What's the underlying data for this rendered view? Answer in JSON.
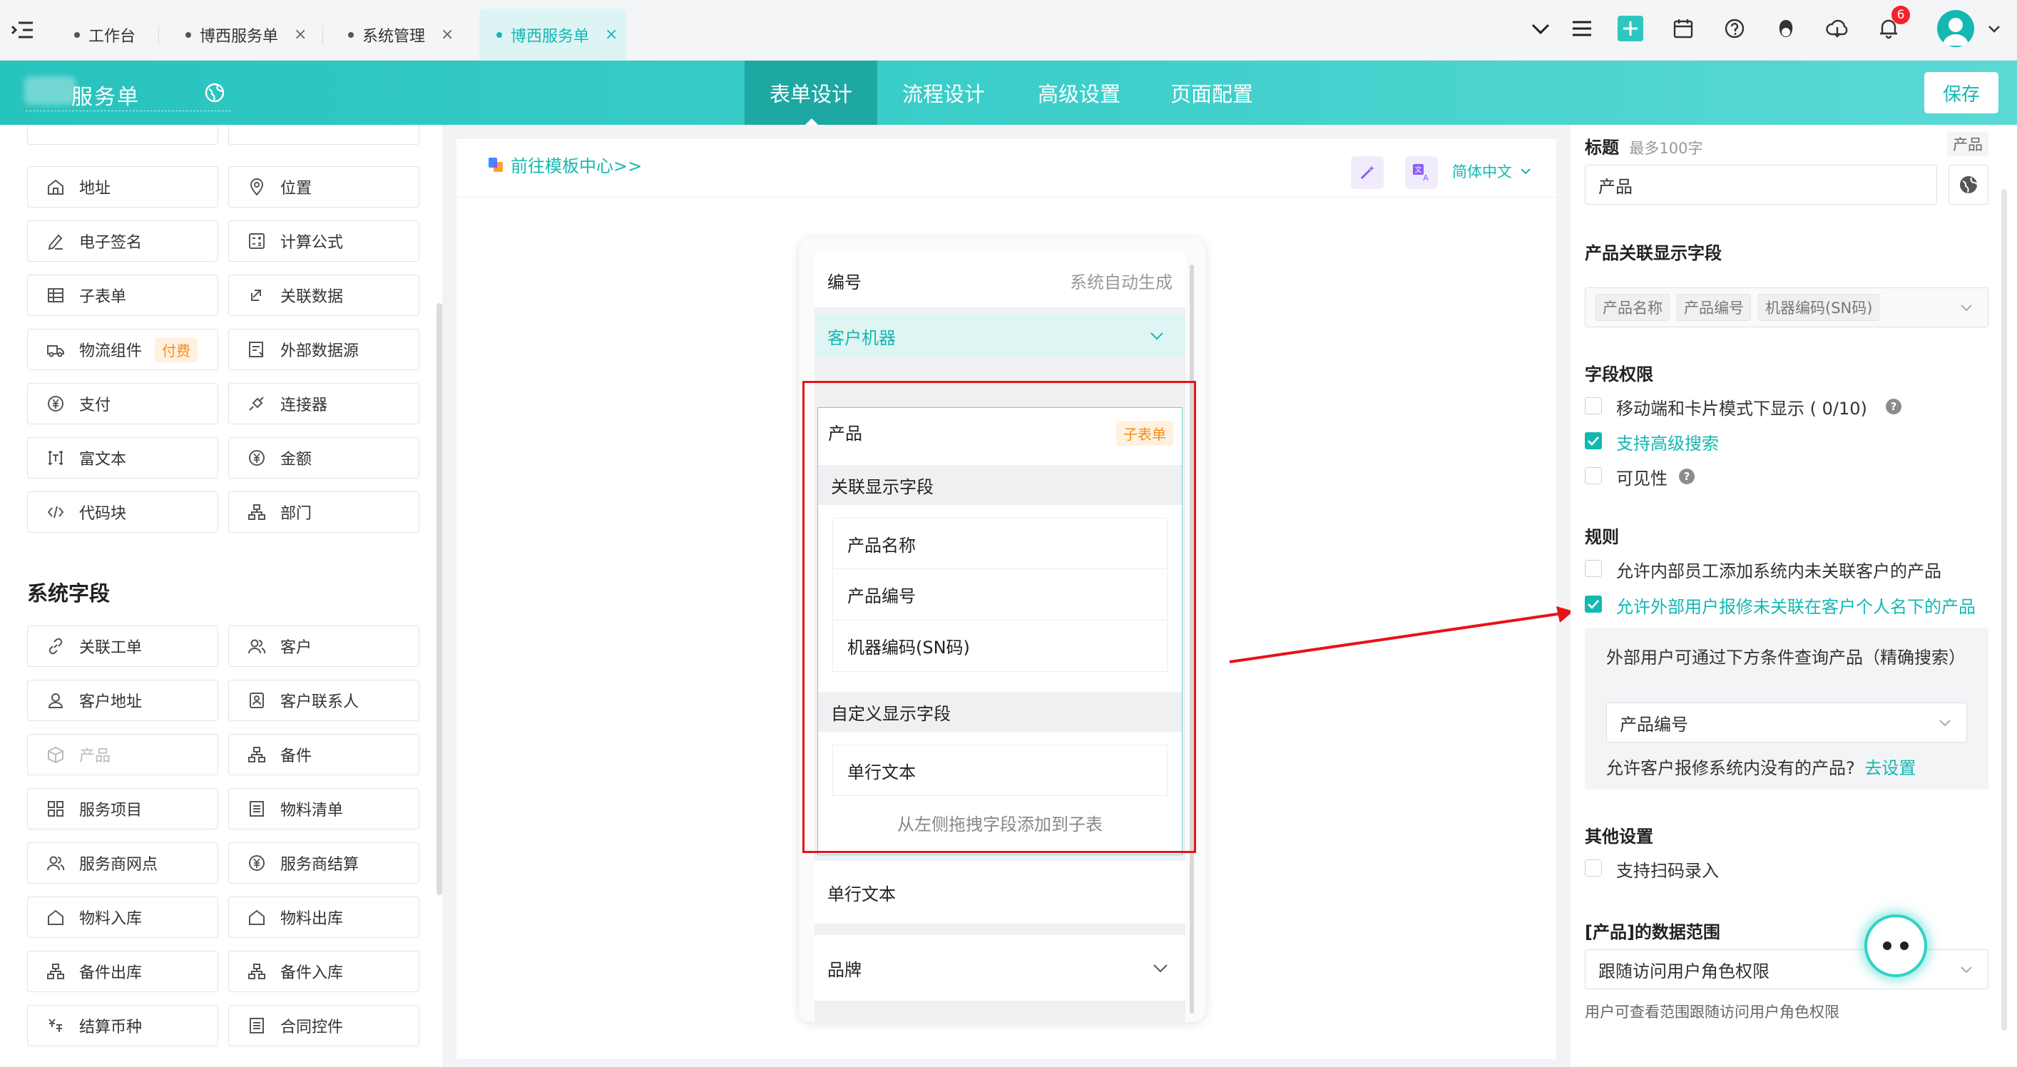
{
  "topbar": {
    "tabs": [
      {
        "label": "工作台",
        "closable": false,
        "active": false
      },
      {
        "label": "博西服务单",
        "closable": true,
        "active": false
      },
      {
        "label": "系统管理",
        "closable": true,
        "active": false
      },
      {
        "label": "博西服务单",
        "closable": true,
        "active": true
      }
    ],
    "close_glyph": "×",
    "notification_count": "6",
    "icons": [
      "chevron-down-icon",
      "list-icon",
      "add-icon",
      "calendar-icon",
      "help-icon",
      "bird-icon",
      "cloud-icon",
      "bell-icon",
      "avatar-icon"
    ]
  },
  "header": {
    "app_name": "服务单",
    "tabs": [
      {
        "label": "表单设计",
        "active": true
      },
      {
        "label": "流程设计",
        "active": false
      },
      {
        "label": "高级设置",
        "active": false
      },
      {
        "label": "页面配置",
        "active": false
      }
    ],
    "save_label": "保存"
  },
  "left_panel": {
    "components": [
      {
        "label": "地址",
        "icon": "home-icon"
      },
      {
        "label": "位置",
        "icon": "location-icon"
      },
      {
        "label": "电子签名",
        "icon": "pen-icon"
      },
      {
        "label": "计算公式",
        "icon": "calculator-icon"
      },
      {
        "label": "子表单",
        "icon": "table-icon"
      },
      {
        "label": "关联数据",
        "icon": "link-data-icon"
      },
      {
        "label": "物流组件",
        "icon": "truck-icon",
        "badge": "付费"
      },
      {
        "label": "外部数据源",
        "icon": "external-data-icon"
      },
      {
        "label": "支付",
        "icon": "yen-circle-icon"
      },
      {
        "label": "连接器",
        "icon": "plug-icon"
      },
      {
        "label": "富文本",
        "icon": "richtext-icon"
      },
      {
        "label": "金额",
        "icon": "yen-circle-icon"
      },
      {
        "label": "代码块",
        "icon": "code-icon"
      },
      {
        "label": "部门",
        "icon": "org-icon"
      }
    ],
    "system_section_title": "系统字段",
    "system_fields": [
      {
        "label": "关联工单",
        "icon": "link-icon"
      },
      {
        "label": "客户",
        "icon": "users-icon"
      },
      {
        "label": "客户地址",
        "icon": "user-location-icon"
      },
      {
        "label": "客户联系人",
        "icon": "contact-icon"
      },
      {
        "label": "产品",
        "icon": "box-icon",
        "disabled": true
      },
      {
        "label": "备件",
        "icon": "org-icon"
      },
      {
        "label": "服务项目",
        "icon": "grid-icon"
      },
      {
        "label": "物料清单",
        "icon": "list-doc-icon"
      },
      {
        "label": "服务商网点",
        "icon": "users-icon"
      },
      {
        "label": "服务商结算",
        "icon": "yen-circle-icon"
      },
      {
        "label": "物料入库",
        "icon": "home-icon"
      },
      {
        "label": "物料出库",
        "icon": "home-icon"
      },
      {
        "label": "备件出库",
        "icon": "org-icon"
      },
      {
        "label": "备件入库",
        "icon": "org-icon"
      },
      {
        "label": "结算币种",
        "icon": "currency-icon"
      },
      {
        "label": "合同控件",
        "icon": "list-doc-icon"
      }
    ]
  },
  "canvas": {
    "template_link": "前往模板中心>>",
    "language": "简体中文",
    "fields": {
      "number_label": "编号",
      "number_placeholder": "系统自动生成",
      "machine_label": "客户机器",
      "product_label": "产品",
      "product_badge": "子表单",
      "linked_section": "关联显示字段",
      "linked_fields": [
        "产品名称",
        "产品编号",
        "机器编码(SN码)"
      ],
      "custom_section": "自定义显示字段",
      "custom_fields": [
        "单行文本"
      ],
      "drag_hint": "从左侧拖拽字段添加到子表",
      "single_text_label": "单行文本",
      "brand_label": "品牌"
    }
  },
  "right_panel": {
    "title_label": "标题",
    "title_hint": "最多100字",
    "title_top_value": "产品",
    "title_value": "产品",
    "display_fields_label": "产品关联显示字段",
    "display_fields_tags": [
      "产品名称",
      "产品编号",
      "机器编码(SN码)"
    ],
    "permission_label": "字段权限",
    "permissions": [
      {
        "label": "移动端和卡片模式下显示 ( 0/10)",
        "checked": false,
        "help": true
      },
      {
        "label": "支持高级搜索",
        "checked": true,
        "help": false
      },
      {
        "label": "可见性",
        "checked": false,
        "help": true
      }
    ],
    "rules_label": "规则",
    "rules": [
      {
        "label": "允许内部员工添加系统内未关联客户的产品",
        "checked": false
      },
      {
        "label": "允许外部用户报修未关联在客户个人名下的产品",
        "checked": true
      }
    ],
    "query_hint": "外部用户可通过下方条件查询产品（精确搜索）",
    "query_field_value": "产品编号",
    "allow_missing_text": "允许客户报修系统内没有的产品?",
    "allow_missing_link": "去设置",
    "other_label": "其他设置",
    "scan_label": "支持扫码录入",
    "scan_checked": false,
    "data_range_label": "[产品]的数据范围",
    "data_range_value": "跟随访问用户角色权限",
    "data_range_hint": "用户可查看范围跟随访问用户角色权限",
    "help_glyph": "?"
  },
  "colors": {
    "brand": "#13b8b2",
    "header_gradient_start": "#27c3bd",
    "alert_red": "#e8121a",
    "paid_orange": "#fa8c16"
  }
}
